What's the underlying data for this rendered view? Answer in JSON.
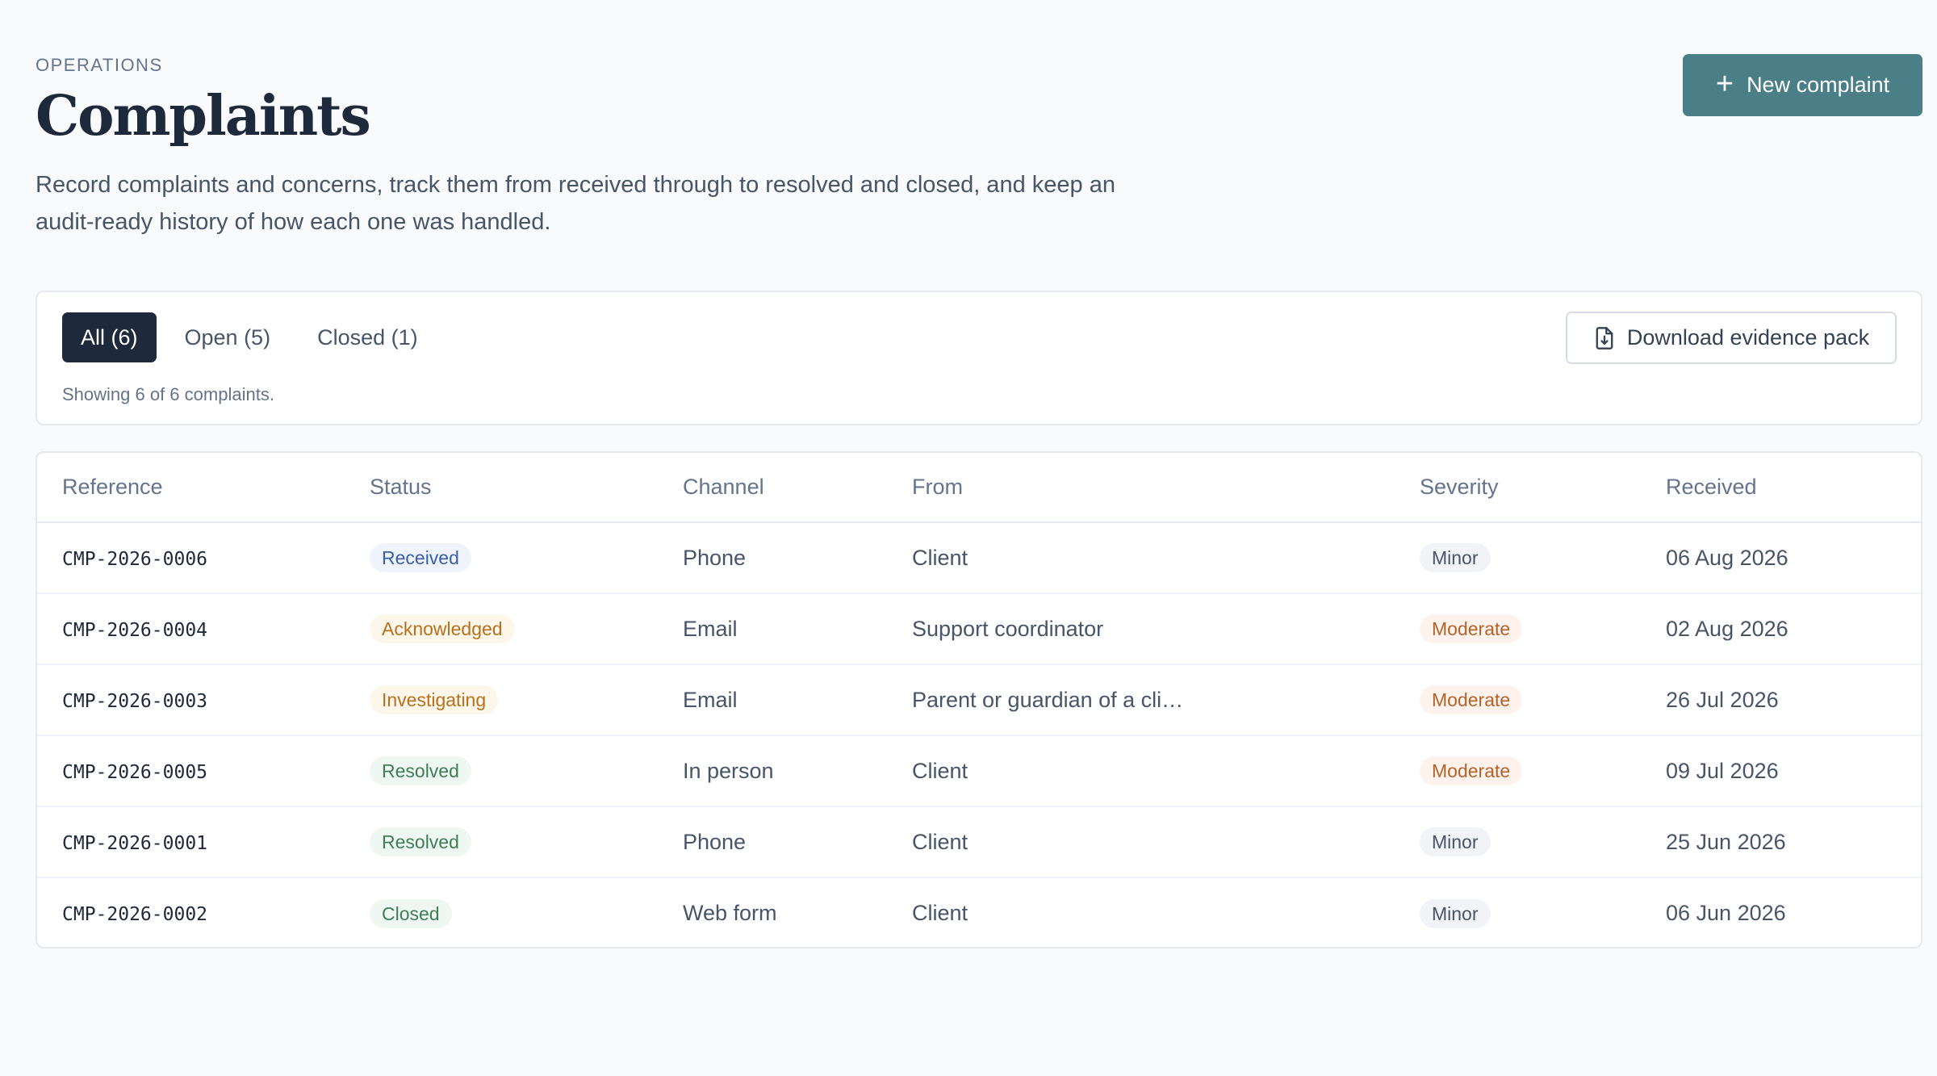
{
  "header": {
    "eyebrow": "OPERATIONS",
    "title": "Complaints",
    "description": "Record complaints and concerns, track them from received through to resolved and closed, and keep an audit-ready history of how each one was handled.",
    "new_button_label": "New complaint",
    "new_button_icon": "plus-icon"
  },
  "filters": {
    "tabs": [
      {
        "label": "All (6)",
        "active": true
      },
      {
        "label": "Open (5)",
        "active": false
      },
      {
        "label": "Closed (1)",
        "active": false
      }
    ],
    "showing_text": "Showing 6 of 6 complaints.",
    "download_label": "Download evidence pack",
    "download_icon": "file-download-icon"
  },
  "table": {
    "columns": [
      "Reference",
      "Status",
      "Channel",
      "From",
      "Severity",
      "Received"
    ],
    "rows": [
      {
        "reference": "CMP-2026-0006",
        "status": "Received",
        "channel": "Phone",
        "from": "Client",
        "severity": "Minor",
        "received": "06 Aug 2026"
      },
      {
        "reference": "CMP-2026-0004",
        "status": "Acknowledged",
        "channel": "Email",
        "from": "Support coordinator",
        "severity": "Moderate",
        "received": "02 Aug 2026"
      },
      {
        "reference": "CMP-2026-0003",
        "status": "Investigating",
        "channel": "Email",
        "from": "Parent or guardian of a cli…",
        "severity": "Moderate",
        "received": "26 Jul 2026"
      },
      {
        "reference": "CMP-2026-0005",
        "status": "Resolved",
        "channel": "In person",
        "from": "Client",
        "severity": "Moderate",
        "received": "09 Jul 2026"
      },
      {
        "reference": "CMP-2026-0001",
        "status": "Resolved",
        "channel": "Phone",
        "from": "Client",
        "severity": "Minor",
        "received": "25 Jun 2026"
      },
      {
        "reference": "CMP-2026-0002",
        "status": "Closed",
        "channel": "Web form",
        "from": "Client",
        "severity": "Minor",
        "received": "06 Jun 2026"
      }
    ]
  },
  "colors": {
    "primary_button": "#4b7f88",
    "active_tab": "#1e293b",
    "background": "#f8fafc"
  }
}
